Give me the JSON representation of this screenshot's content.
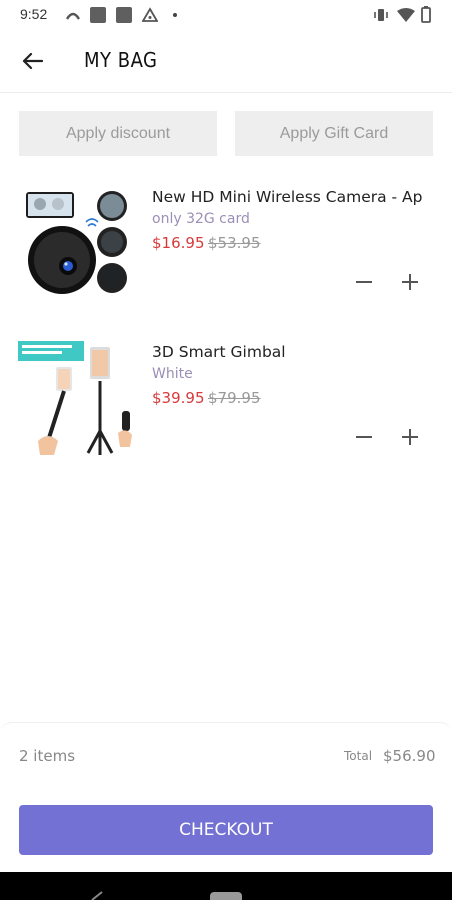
{
  "status_bar": {
    "time": "9:52"
  },
  "header": {
    "title": "MY BAG"
  },
  "promo": {
    "discount_label": "Apply discount",
    "gift_label": "Apply Gift Card"
  },
  "items": [
    {
      "name": "New HD Mini Wireless Camera - App",
      "variant": "only 32G card",
      "price": "$16.95",
      "original_price": "$53.95",
      "image": "mini-camera-product-image"
    },
    {
      "name": "3D Smart Gimbal",
      "variant": "White",
      "price": "$39.95",
      "original_price": "$79.95",
      "image": "gimbal-product-image"
    }
  ],
  "footer": {
    "count": "2 items",
    "total_label": "Total",
    "total_value": "$56.90",
    "checkout_label": "CHECKOUT"
  },
  "colors": {
    "accent": "#7371d3",
    "sale_price": "#d83a3a",
    "variant_text": "#9b8fb6"
  }
}
